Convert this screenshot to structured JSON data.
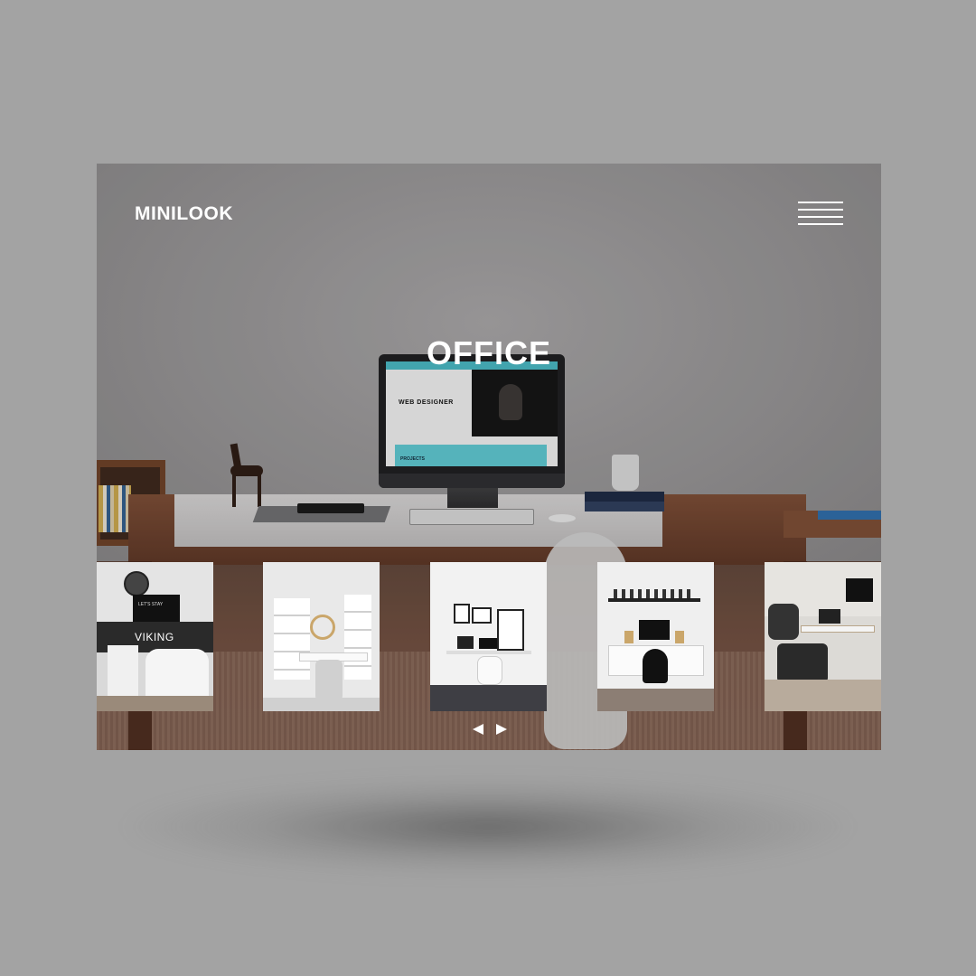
{
  "brand": {
    "logo_text": "MINILOOK"
  },
  "header": {
    "menu_icon": "hamburger-menu-icon"
  },
  "hero": {
    "title": "OFFICE",
    "monitor_screen": {
      "headline": "WEB DESIGNER",
      "band_label": "PROJECTS"
    }
  },
  "gallery": {
    "items": [
      {
        "label": "VIKING",
        "monitor_text": "LET'S STAY"
      },
      {
        "label": ""
      },
      {
        "label": ""
      },
      {
        "label": ""
      },
      {
        "label": ""
      }
    ],
    "prev_icon": "caret-left-icon",
    "next_icon": "caret-right-icon"
  },
  "colors": {
    "page_background": "#a3a3a3",
    "accent_teal": "#46b6c1",
    "text": "#ffffff"
  }
}
